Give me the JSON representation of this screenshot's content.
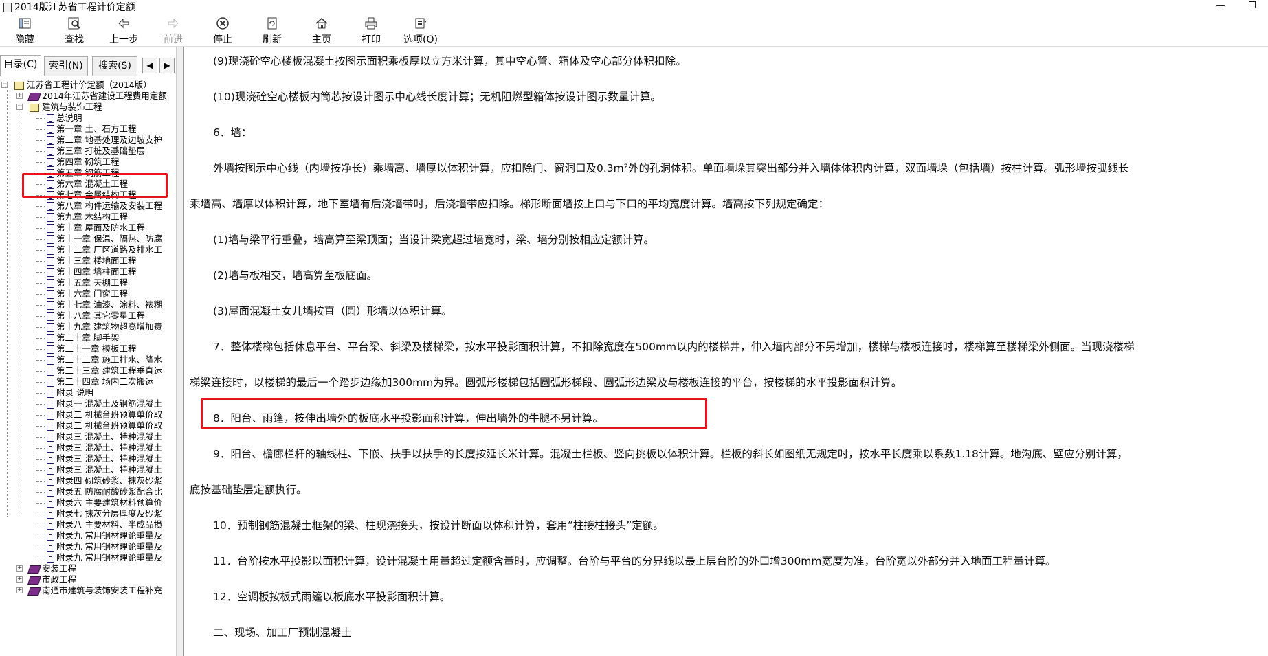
{
  "window": {
    "title": "2014版江苏省工程计价定额",
    "minimize_glyph": "—",
    "restore_glyph": "❐"
  },
  "toolbar": [
    {
      "label": "隐藏",
      "icon": "hide-pane-icon",
      "enabled": true
    },
    {
      "label": "查找",
      "icon": "find-icon",
      "enabled": true
    },
    {
      "label": "上一步",
      "icon": "back-arrow-icon",
      "enabled": true
    },
    {
      "label": "前进",
      "icon": "forward-arrow-icon",
      "enabled": false
    },
    {
      "label": "停止",
      "icon": "stop-icon",
      "enabled": true
    },
    {
      "label": "刷新",
      "icon": "refresh-icon",
      "enabled": true
    },
    {
      "label": "主页",
      "icon": "home-icon",
      "enabled": true
    },
    {
      "label": "打印",
      "icon": "print-icon",
      "enabled": true
    },
    {
      "label": "选项(O)",
      "icon": "options-icon",
      "enabled": true
    }
  ],
  "tabs": [
    {
      "label": "目录(C)",
      "active": true
    },
    {
      "label": "索引(N)",
      "active": false
    },
    {
      "label": "搜索(S)",
      "active": false
    }
  ],
  "tab_scroll": {
    "left": "◀",
    "right": "▶"
  },
  "tree": {
    "root": "江苏省工程计价定额（2014版）",
    "top_books": [
      "2014年江苏省建设工程费用定额",
      "建筑与装饰工程"
    ],
    "chapters": [
      "总说明",
      "第一章  土、石方工程",
      "第二章  地基处理及边坡支护",
      "第三章  打桩及基础垫层",
      "第四章  砌筑工程",
      "第五章  钢筋工程",
      "第六章  混凝土工程",
      "第七章  金属结构工程",
      "第八章  构件运输及安装工程",
      "第九章  木结构工程",
      "第十章  屋面及防水工程",
      "第十一章  保温、隔热、防腐",
      "第十二章  厂区道路及排水工",
      "第十三章  楼地面工程",
      "第十四章  墙柱面工程",
      "第十五章  天棚工程",
      "第十六章  门窗工程",
      "第十七章  油漆、涂料、裱糊",
      "第十八章  其它零星工程",
      "第十九章  建筑物超高增加费",
      "第二十章  脚手架",
      "第二十一章  模板工程",
      "第二十二章  施工排水、降水",
      "第二十三章  建筑工程垂直运",
      "第二十四章  场内二次搬运",
      "附录  说明",
      "附录一  混凝土及钢筋混凝土",
      "附录二  机械台班预算单价取",
      "附录二  机械台班预算单价取",
      "附录三  混凝土、特种混凝土",
      "附录三  混凝土、特种混凝土",
      "附录三  混凝土、特种混凝土",
      "附录三  混凝土、特种混凝土",
      "附录四  砌筑砂浆、抹灰砂浆",
      "附录五  防腐耐酸砂浆配合比",
      "附录六  主要建筑材料预算价",
      "附录七  抹灰分层厚度及砂浆",
      "附录八  主要材料、半成品损",
      "附录九  常用钢材理论重量及",
      "附录九  常用钢材理论重量及",
      "附录九  常用钢材理论重量及"
    ],
    "bottom_books": [
      "安装工程",
      "市政工程",
      "南通市建筑与装饰安装工程补充"
    ]
  },
  "content": {
    "paragraphs": [
      "(9)现浇砼空心楼板混凝土按图示面积乘板厚以立方米计算，其中空心管、箱体及空心部分体积扣除。",
      "(10)现浇砼空心楼板内筒芯按设计图示中心线长度计算；无机阻燃型箱体按设计图示数量计算。",
      "6．墙：",
      "外墙按图示中心线（内墙按净长）乘墙高、墙厚以体积计算，应扣除门、窗洞口及0.3m²外的孔洞体积。单面墙垛其突出部分并入墙体体积内计算，双面墙垛（包括墙）按柱计算。弧形墙按弧线长",
      "乘墙高、墙厚以体积计算，地下室墙有后浇墙带时，后浇墙带应扣除。梯形断面墙按上口与下口的平均宽度计算。墙高按下列规定确定：",
      "(1)墙与梁平行重叠，墙高算至梁顶面；当设计梁宽超过墙宽时，梁、墙分别按相应定额计算。",
      "(2)墙与板相交，墙高算至板底面。",
      "(3)屋面混凝土女儿墙按直（圆）形墙以体积计算。",
      "7．整体楼梯包括休息平台、平台梁、斜梁及楼梯梁，按水平投影面积计算，不扣除宽度在500mm以内的楼梯井，伸入墙内部分不另增加，楼梯与楼板连接时，楼梯算至楼梯梁外侧面。当现浇楼梯",
      "梯梁连接时，以楼梯的最后一个踏步边缘加300mm为界。圆弧形楼梯包括圆弧形梯段、圆弧形边梁及与楼板连接的平台，按楼梯的水平投影面积计算。",
      "8．阳台、雨篷，按伸出墙外的板底水平投影面积计算，伸出墙外的牛腿不另计算。",
      "9．阳台、檐廊栏杆的轴线柱、下嵌、扶手以扶手的长度按延长米计算。混凝土栏板、竖向挑板以体积计算。栏板的斜长如图纸无规定时，按水平长度乘以系数1.18计算。地沟底、壁应分别计算，",
      "底按基础垫层定额执行。",
      "10．预制钢筋混凝土框架的梁、柱现浇接头，按设计断面以体积计算，套用“柱接柱接头”定额。",
      "11．台阶按水平投影以面积计算，设计混凝土用量超过定额含量时，应调整。台阶与平台的分界线以最上层台阶的外口增300mm宽度为准，台阶宽以外部分并入地面工程量计算。",
      "12．空调板按板式雨篷以板底水平投影面积计算。",
      "二、现场、加工厂预制混凝土"
    ]
  },
  "highlights": {
    "color": "#e8141b",
    "tree_item": "第六章  混凝土工程",
    "paragraph": "8．阳台、雨篷，按伸出墙外的板底水平投影面积计算，伸出墙外的牛腿不另计算。"
  }
}
